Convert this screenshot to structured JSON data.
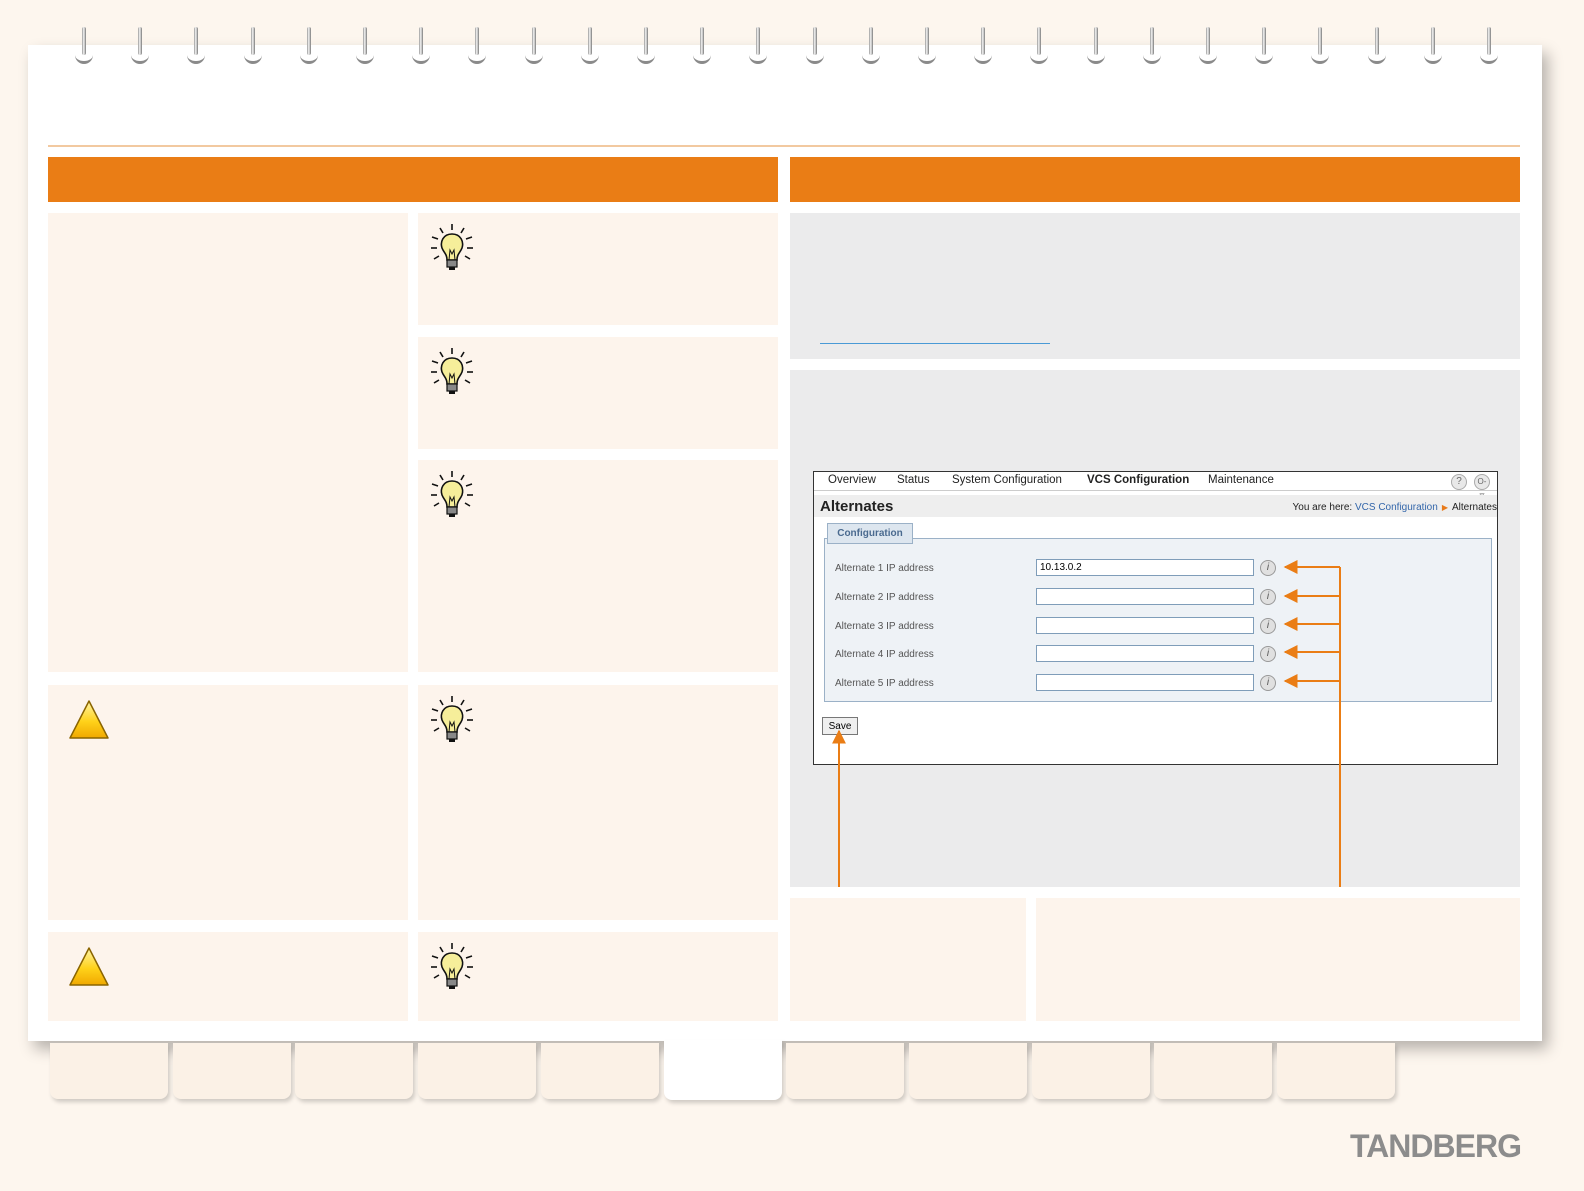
{
  "screenshot": {
    "nav": {
      "items": [
        "Overview",
        "Status",
        "System Configuration",
        "VCS Configuration",
        "Maintenance"
      ],
      "active": "VCS Configuration",
      "help_icon": "?",
      "logout_icon": "O-π"
    },
    "page_title": "Alternates",
    "breadcrumb": {
      "prefix": "You are here:",
      "link": "VCS Configuration",
      "current": "Alternates"
    },
    "section_tab": "Configuration",
    "fields": [
      {
        "label": "Alternate 1 IP address",
        "value": "10.13.0.2"
      },
      {
        "label": "Alternate 2 IP address",
        "value": ""
      },
      {
        "label": "Alternate 3 IP address",
        "value": ""
      },
      {
        "label": "Alternate 4 IP address",
        "value": ""
      },
      {
        "label": "Alternate 5 IP address",
        "value": ""
      }
    ],
    "info_icon": "i",
    "save_label": "Save"
  },
  "brand": {
    "logo": "TANDBERG"
  },
  "colors": {
    "accent": "#ea7d15",
    "panel_warm": "#fdf4ec",
    "panel_grey": "#ebebec",
    "link": "#3366aa"
  },
  "icons": {
    "tips": "lightbulb-icon",
    "warnings": "warning-triangle-icon"
  }
}
